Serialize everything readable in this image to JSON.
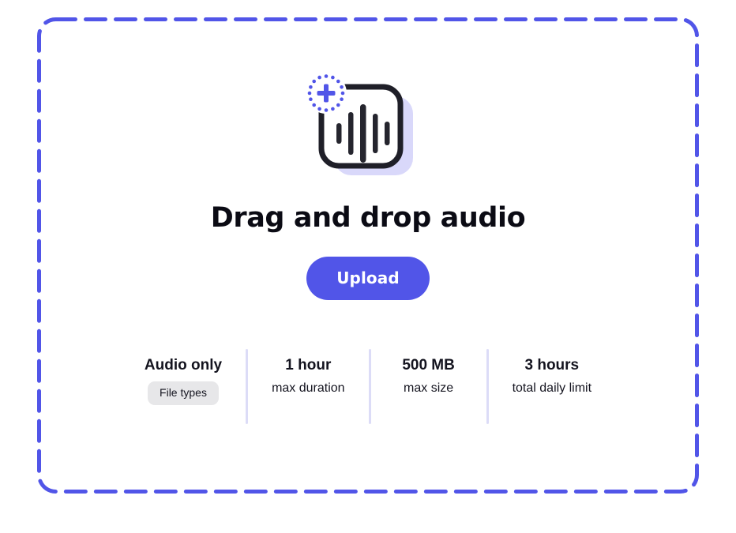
{
  "dropzone": {
    "name": "audio-dropzone",
    "border_color": "#5155e8",
    "headline": "Drag and drop audio",
    "upload_label": "Upload"
  },
  "illustration": {
    "icon_name": "add-audio-file-icon",
    "card_outline_color": "#1f1f28",
    "accent_color": "#5155e8",
    "shadow_card_color": "#d9d8fa",
    "waveform_bar_count": 5
  },
  "stats": [
    {
      "value": "Audio only",
      "badge": "File types",
      "label": ""
    },
    {
      "value": "1 hour",
      "badge": "",
      "label": "max duration"
    },
    {
      "value": "500 MB",
      "badge": "",
      "label": "max size"
    },
    {
      "value": "3 hours",
      "badge": "",
      "label": "total daily limit"
    }
  ],
  "colors": {
    "accent": "#5155e8",
    "divider": "#dcdcf7",
    "badge_bg": "#e7e7e9",
    "text": "#14141f",
    "page_bg": "#ffffff"
  }
}
